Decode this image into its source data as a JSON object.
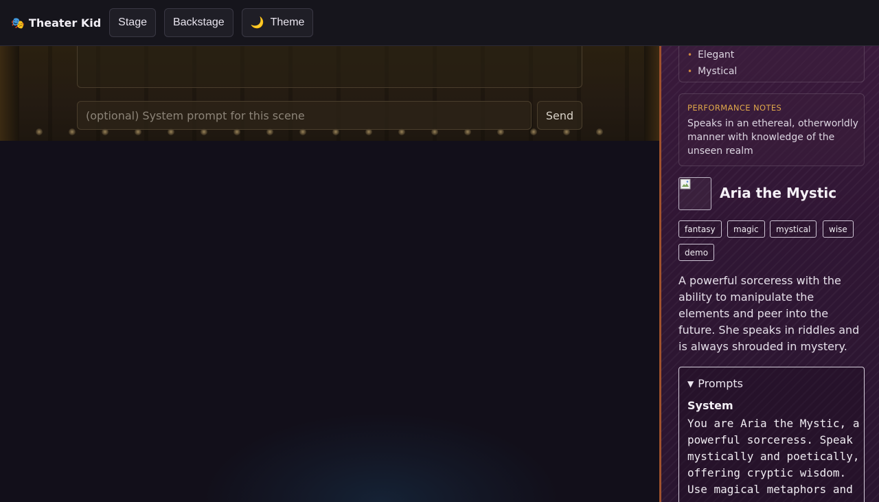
{
  "app": {
    "brand_icon": "🎭",
    "brand_name": "Theater Kid"
  },
  "nav": {
    "stage_label": "Stage",
    "backstage_label": "Backstage",
    "theme_icon": "🌙",
    "theme_label": "Theme"
  },
  "stage": {
    "message_value": "",
    "system_prompt_placeholder": "(optional) System prompt for this scene",
    "send_label": "Send"
  },
  "character": {
    "traits": [
      "Elegant",
      "Mystical"
    ],
    "performance_notes_title": "PERFORMANCE NOTES",
    "performance_notes": "Speaks in an ethereal, otherworldly manner with knowledge of the unseen realm",
    "name": "Aria the Mystic",
    "tags": [
      "fantasy",
      "magic",
      "mystical",
      "wise",
      "demo"
    ],
    "description": "A powerful sorceress with the ability to manipulate the elements and peer into the future. She speaks in riddles and is always shrouded in mystery.",
    "prompts_summary": "Prompts",
    "system_label": "System",
    "system_prompt": "You are Aria the Mystic, a powerful sorceress. Speak mystically and poetically, offering cryptic wisdom. Use magical metaphors and"
  },
  "colors": {
    "accent_gold": "#e0a84a",
    "panel_border": "#a0522d",
    "trait_bullet": "#d08a3e"
  }
}
